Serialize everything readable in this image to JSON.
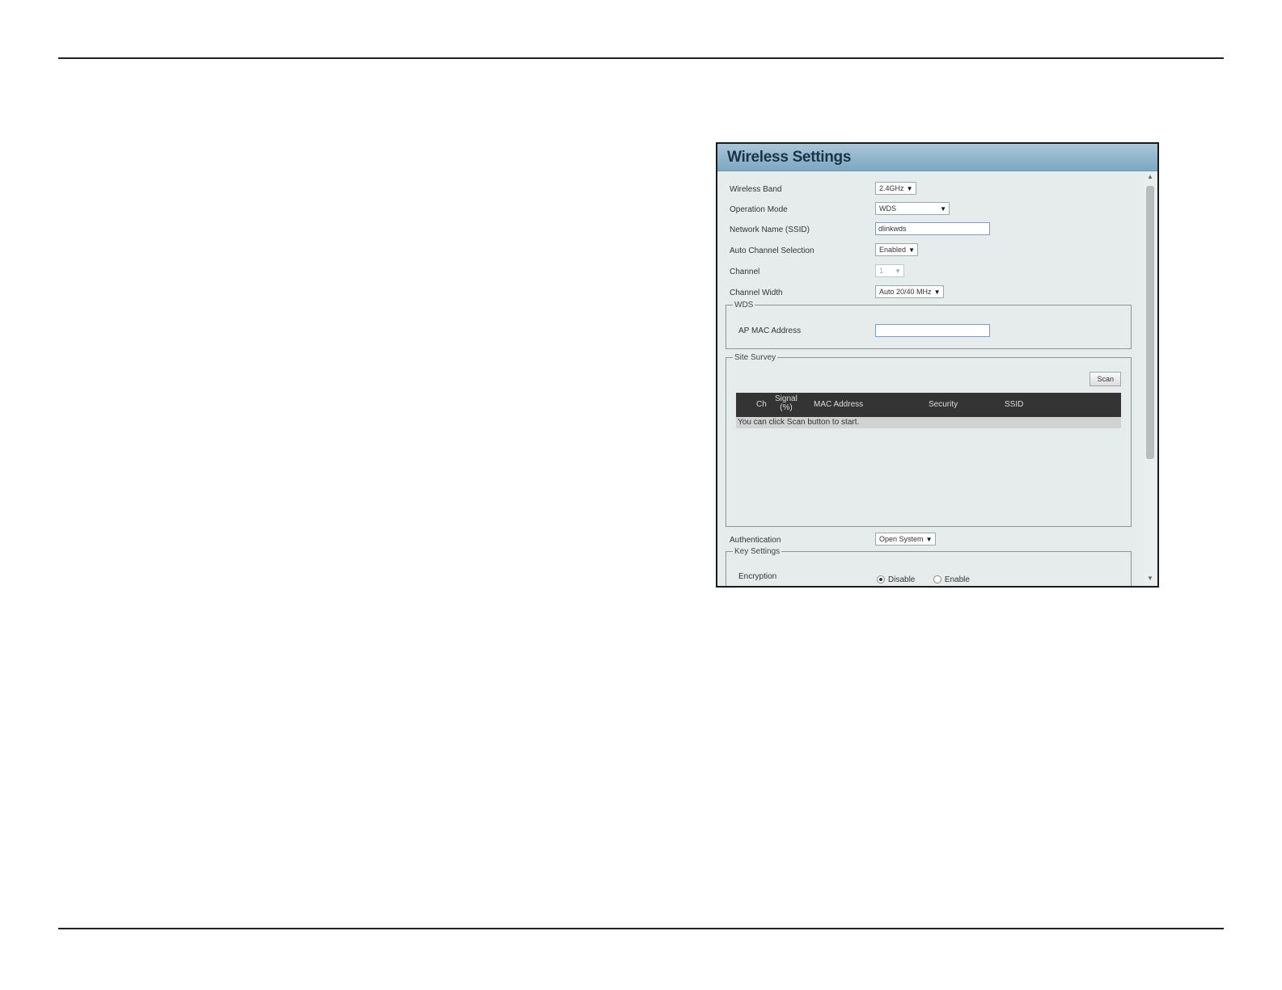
{
  "panel": {
    "title": "Wireless Settings",
    "fields": {
      "wireless_band": {
        "label": "Wireless Band",
        "value": "2.4GHz"
      },
      "operation_mode": {
        "label": "Operation Mode",
        "value": "WDS"
      },
      "network_name": {
        "label": "Network Name (SSID)",
        "value": "dlinkwds"
      },
      "auto_channel": {
        "label": "Auto Channel Selection",
        "value": "Enabled"
      },
      "channel": {
        "label": "Channel",
        "value": "1"
      },
      "channel_width": {
        "label": "Channel Width",
        "value": "Auto 20/40 MHz"
      }
    },
    "wds": {
      "legend": "WDS",
      "ap_mac": {
        "label": "AP MAC Address",
        "value": ""
      }
    },
    "site_survey": {
      "legend": "Site Survey",
      "scan_label": "Scan",
      "columns": {
        "ch": "Ch",
        "signal_top": "Signal",
        "signal_bottom": "(%)",
        "mac": "MAC Address",
        "security": "Security",
        "ssid": "SSID"
      },
      "empty_message": "You can click Scan button to start."
    },
    "authentication": {
      "label": "Authentication",
      "value": "Open System"
    },
    "key_settings": {
      "legend": "Key Settings",
      "encryption": {
        "label": "Encryption",
        "options": [
          "Disable",
          "Enable"
        ],
        "selected": "Disable"
      }
    }
  },
  "icons": {
    "dropdown_arrow": "▼",
    "scroll_up": "▲",
    "scroll_down": "▼"
  }
}
